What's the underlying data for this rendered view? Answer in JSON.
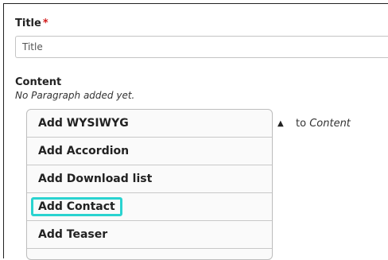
{
  "title_field": {
    "label": "Title",
    "required_mark": "*",
    "value": "",
    "placeholder": "Title"
  },
  "content_field": {
    "label": "Content",
    "empty_note": "No Paragraph added yet.",
    "dropdown_items": [
      "Add WYSIWYG",
      "Add Accordion",
      "Add Download list",
      "Add Contact",
      "Add Teaser"
    ],
    "highlighted_item": "Add Contact",
    "to_text": "to",
    "to_target": "Content"
  },
  "colors": {
    "required": "#d21a1a",
    "highlight": "#2ad3d0"
  },
  "icons": {
    "scroll_up": "triangle-up-icon"
  }
}
